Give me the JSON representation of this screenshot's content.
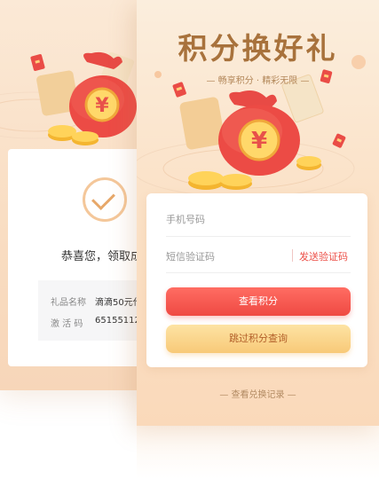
{
  "back_screen": {
    "congrats_text": "恭喜您，领取成",
    "gift_name_label": "礼品名称",
    "gift_name_value": "滴滴50元代",
    "activation_code_label": "激 活 码",
    "activation_code_value": "65155112"
  },
  "front_screen": {
    "title": "积分换好礼",
    "subtitle": "— 畅享积分 · 精彩无限 —",
    "phone_placeholder": "手机号码",
    "sms_code_placeholder": "短信验证码",
    "send_code_label": "发送验证码",
    "check_points_label": "查看积分",
    "skip_query_label": "跳过积分查询",
    "records_link": "— 查看兑换记录 —"
  },
  "icons": {
    "money_bag": "money-bag-icon",
    "coin": "coin-icon",
    "envelope": "red-envelope-icon",
    "check": "check-icon"
  },
  "colors": {
    "accent_red": "#ef4942",
    "accent_gold": "#f8c978",
    "title_brown": "#a8723c",
    "background_peach": "#fbe2c8"
  }
}
